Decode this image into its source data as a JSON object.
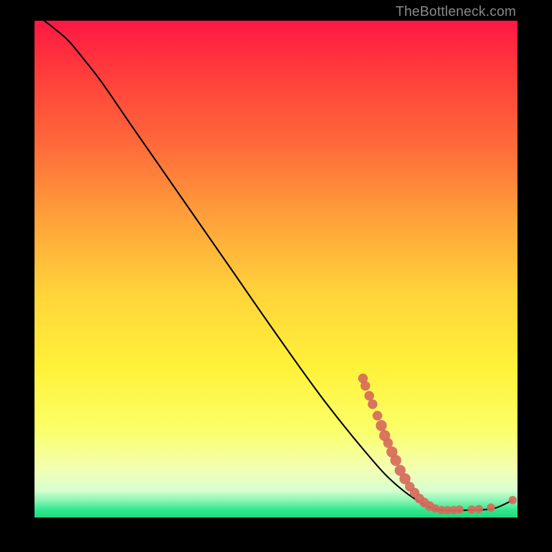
{
  "watermark": "TheBottleneck.com",
  "chart_data": {
    "type": "line",
    "title": "",
    "xlabel": "",
    "ylabel": "",
    "xlim": [
      0,
      100
    ],
    "ylim": [
      0,
      100
    ],
    "grid": false,
    "legend": false,
    "gradient_stops": [
      {
        "offset": 0.0,
        "color": "#ff1744"
      },
      {
        "offset": 0.1,
        "color": "#ff3b3b"
      },
      {
        "offset": 0.25,
        "color": "#ff6a3a"
      },
      {
        "offset": 0.4,
        "color": "#ffa23a"
      },
      {
        "offset": 0.55,
        "color": "#ffd43a"
      },
      {
        "offset": 0.7,
        "color": "#fff23a"
      },
      {
        "offset": 0.82,
        "color": "#fbff66"
      },
      {
        "offset": 0.9,
        "color": "#f4ffb0"
      },
      {
        "offset": 0.945,
        "color": "#d9ffd0"
      },
      {
        "offset": 0.965,
        "color": "#8ef5b5"
      },
      {
        "offset": 0.985,
        "color": "#2ee88e"
      },
      {
        "offset": 1.0,
        "color": "#1fd97a"
      }
    ],
    "curve": [
      {
        "x": 2.0,
        "y": 100.0
      },
      {
        "x": 4.0,
        "y": 98.5
      },
      {
        "x": 7.0,
        "y": 96.0
      },
      {
        "x": 10.0,
        "y": 92.5
      },
      {
        "x": 14.0,
        "y": 87.5
      },
      {
        "x": 20.0,
        "y": 79.0
      },
      {
        "x": 30.0,
        "y": 65.0
      },
      {
        "x": 40.0,
        "y": 51.0
      },
      {
        "x": 50.0,
        "y": 37.0
      },
      {
        "x": 60.0,
        "y": 23.5
      },
      {
        "x": 70.0,
        "y": 11.5
      },
      {
        "x": 75.0,
        "y": 6.5
      },
      {
        "x": 80.0,
        "y": 3.0
      },
      {
        "x": 84.0,
        "y": 1.5
      },
      {
        "x": 90.0,
        "y": 1.5
      },
      {
        "x": 95.0,
        "y": 1.8
      },
      {
        "x": 99.0,
        "y": 3.5
      }
    ],
    "dot_clusters": [
      {
        "x": 68.0,
        "y": 28.0,
        "color": "#d66a5a",
        "r": 7
      },
      {
        "x": 68.5,
        "y": 26.5,
        "color": "#d66a5a",
        "r": 7
      },
      {
        "x": 69.3,
        "y": 24.5,
        "color": "#d66a5a",
        "r": 7
      },
      {
        "x": 70.0,
        "y": 22.8,
        "color": "#d66a5a",
        "r": 7
      },
      {
        "x": 71.0,
        "y": 20.5,
        "color": "#d66a5a",
        "r": 7
      },
      {
        "x": 71.8,
        "y": 18.5,
        "color": "#d66a5a",
        "r": 8
      },
      {
        "x": 72.5,
        "y": 16.5,
        "color": "#d66a5a",
        "r": 8
      },
      {
        "x": 73.2,
        "y": 15.0,
        "color": "#d66a5a",
        "r": 7
      },
      {
        "x": 74.0,
        "y": 13.2,
        "color": "#d66a5a",
        "r": 8
      },
      {
        "x": 74.8,
        "y": 11.5,
        "color": "#d66a5a",
        "r": 8
      },
      {
        "x": 75.7,
        "y": 9.5,
        "color": "#d66a5a",
        "r": 8
      },
      {
        "x": 76.7,
        "y": 7.8,
        "color": "#d66a5a",
        "r": 8
      },
      {
        "x": 77.7,
        "y": 6.2,
        "color": "#d66a5a",
        "r": 7
      },
      {
        "x": 78.7,
        "y": 5.0,
        "color": "#d66a5a",
        "r": 7
      },
      {
        "x": 79.7,
        "y": 3.8,
        "color": "#d66a5a",
        "r": 7
      },
      {
        "x": 80.7,
        "y": 3.0,
        "color": "#d66a5a",
        "r": 7
      },
      {
        "x": 81.8,
        "y": 2.3,
        "color": "#d66a5a",
        "r": 7
      },
      {
        "x": 83.0,
        "y": 1.8,
        "color": "#d66a5a",
        "r": 6
      },
      {
        "x": 84.3,
        "y": 1.5,
        "color": "#d66a5a",
        "r": 6
      },
      {
        "x": 85.5,
        "y": 1.5,
        "color": "#d66a5a",
        "r": 6
      },
      {
        "x": 86.8,
        "y": 1.5,
        "color": "#d66a5a",
        "r": 6
      },
      {
        "x": 88.0,
        "y": 1.6,
        "color": "#d66a5a",
        "r": 6
      },
      {
        "x": 90.5,
        "y": 1.6,
        "color": "#d66a5a",
        "r": 6
      },
      {
        "x": 92.0,
        "y": 1.7,
        "color": "#d66a5a",
        "r": 6
      },
      {
        "x": 94.5,
        "y": 2.0,
        "color": "#d66a5a",
        "r": 6
      },
      {
        "x": 99.0,
        "y": 3.5,
        "color": "#d66a5a",
        "r": 6
      }
    ]
  }
}
